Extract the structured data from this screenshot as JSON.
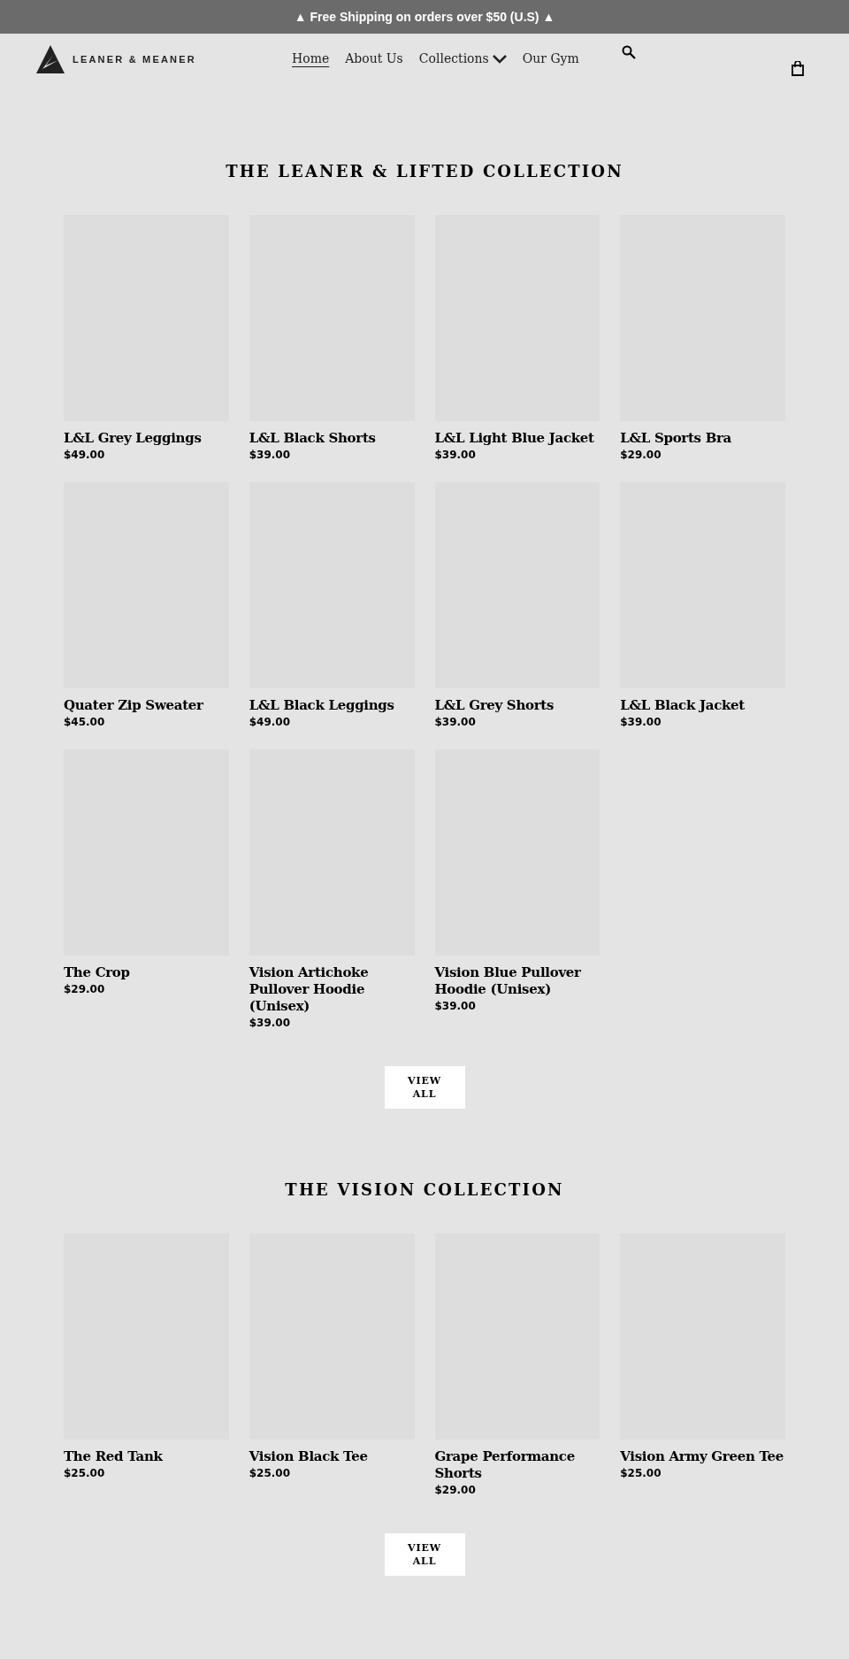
{
  "announcement": "▲ Free Shipping on orders over $50 (U.S) ▲",
  "header": {
    "logo_text": "LEANER & MEANER",
    "nav": [
      {
        "label": "Home",
        "selected": true,
        "dropdown": false
      },
      {
        "label": "About Us",
        "selected": false,
        "dropdown": false
      },
      {
        "label": "Collections",
        "selected": false,
        "dropdown": true
      },
      {
        "label": "Our Gym",
        "selected": false,
        "dropdown": false
      }
    ]
  },
  "sections": [
    {
      "title": "THE LEANER & LIFTED COLLECTION",
      "button": "VIEW ALL",
      "products": [
        {
          "name": "L&L Grey Leggings",
          "price": "$49.00"
        },
        {
          "name": "L&L Black Shorts",
          "price": "$39.00"
        },
        {
          "name": "L&L Light Blue Jacket",
          "price": "$39.00"
        },
        {
          "name": "L&L Sports Bra",
          "price": "$29.00"
        },
        {
          "name": "Quater Zip Sweater",
          "price": "$45.00"
        },
        {
          "name": "L&L Black Leggings",
          "price": "$49.00"
        },
        {
          "name": "L&L Grey Shorts",
          "price": "$39.00"
        },
        {
          "name": "L&L Black Jacket",
          "price": "$39.00"
        },
        {
          "name": "The Crop",
          "price": "$29.00"
        },
        {
          "name": "Vision Artichoke Pullover Hoodie (Unisex)",
          "price": "$39.00"
        },
        {
          "name": "Vision Blue Pullover Hoodie (Unisex)",
          "price": "$39.00"
        }
      ]
    },
    {
      "title": "THE VISION COLLECTION",
      "button": "VIEW ALL",
      "products": [
        {
          "name": "The Red Tank",
          "price": "$25.00"
        },
        {
          "name": "Vision Black Tee",
          "price": "$25.00"
        },
        {
          "name": "Grape Performance Shorts",
          "price": "$29.00"
        },
        {
          "name": "Vision Army Green Tee",
          "price": "$25.00"
        }
      ]
    }
  ]
}
